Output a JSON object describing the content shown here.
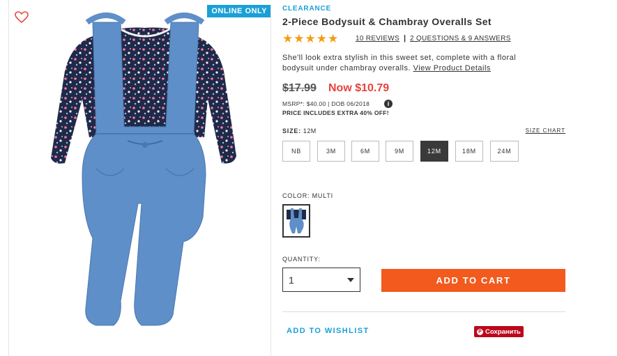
{
  "badge": {
    "online_only": "ONLINE ONLY"
  },
  "product": {
    "label": "CLEARANCE",
    "title": "2-Piece Bodysuit & Chambray Overalls Set",
    "rating_stars": "★★★★★",
    "rating": 5,
    "reviews_link": "10 REVIEWS",
    "separator": "|",
    "qa_link": "2 QUESTIONS & 9 ANSWERS",
    "description": "She'll look extra stylish in this sweet set, complete with a floral bodysuit under chambray overalls.",
    "details_link": "View Product Details"
  },
  "price": {
    "original": "$17.99",
    "now": "Now $10.79",
    "msrp_line": "MSRP*: $40.00 | DOB 06/2018",
    "info_icon": "i",
    "extra_off": "PRICE INCLUDES EXTRA 40% OFF!"
  },
  "size": {
    "label": "SIZE:",
    "selected": "12M",
    "chart_link": "SIZE CHART",
    "options": [
      "NB",
      "3M",
      "6M",
      "9M",
      "12M",
      "18M",
      "24M"
    ]
  },
  "color": {
    "label": "COLOR: MULTI"
  },
  "quantity": {
    "label": "QUANTITY:",
    "value": "1"
  },
  "actions": {
    "add_to_cart": "ADD TO CART",
    "wishlist": "ADD TO WISHLIST",
    "pinterest": "Сохранить",
    "pinterest_icon": "P"
  },
  "colors": {
    "accent": "#1aa0d6",
    "cta": "#f25a1e",
    "sale": "#e8433d",
    "stars": "#f39c12",
    "pinterest": "#bd081c"
  }
}
